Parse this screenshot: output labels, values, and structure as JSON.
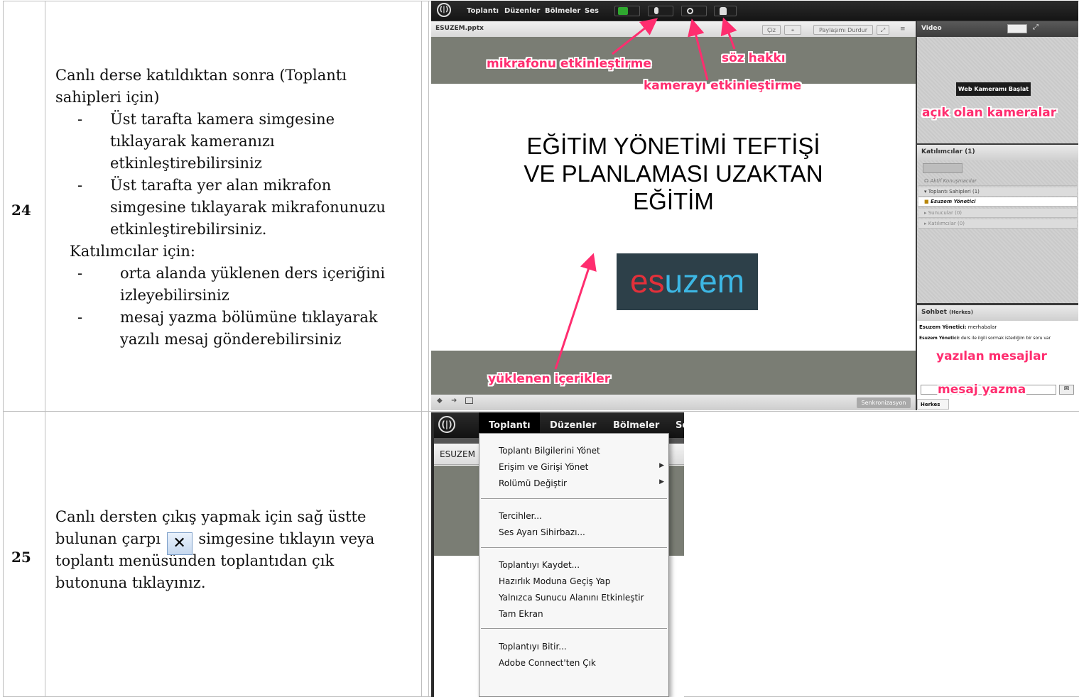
{
  "rows": [
    {
      "number": "24",
      "intro": [
        "Canlı derse katıldıktan sonra (Toplantı",
        "sahipleri için)"
      ],
      "bullets1": [
        [
          "Üst tarafta  kamera simgesine",
          "tıklayarak kameranızı",
          "etkinleştirebilirsiniz"
        ],
        [
          "Üst tarafta yer alan mikrafon",
          "simgesine tıklayarak mikrafonunuzu",
          "etkinleştirebilirsiniz."
        ]
      ],
      "participants_heading": "Katılımcılar için:",
      "bullets2": [
        [
          "orta alanda yüklenen ders içeriğini",
          "izleyebilirsiniz"
        ],
        [
          "mesaj yazma bölümüne tıklayarak",
          "yazılı mesaj gönderebilirsiniz"
        ]
      ],
      "dash": "-"
    },
    {
      "number": "25",
      "line1": "Canlı dersten çıkış yapmak için sağ üstte",
      "line2a": "bulunan çarpı",
      "line2b": "simgesine tıklayın veya",
      "line3": "toplantı menüsünden toplantıdan çık",
      "line4": "butonuna tıklayınız.",
      "close_glyph": "✕"
    }
  ],
  "screenshot1": {
    "menu": [
      "Toplantı",
      "Düzenler",
      "Bölmeler",
      "Ses"
    ],
    "share_pod": {
      "title": "ESUZEM.pptx",
      "draw_btn": "Çiz",
      "stop_btn": "Paylaşımı Durdur",
      "sync_btn": "Senkronizasyon",
      "slide_title": [
        "EĞİTİM YÖNETİMİ TEFTİŞİ",
        "VE PLANLAMASI UZAKTAN",
        "EĞİTİM"
      ],
      "logo_es": "es",
      "logo_uzem": "uzem"
    },
    "video_pod": {
      "title": "Video",
      "start_btn": "Web Kameramı Başlat"
    },
    "attendees_pod": {
      "title": "Katılımcılar",
      "count": "(1)",
      "active": "Aktif Konuşmacılar",
      "hosts": "▾ Toplantı Sahipleri (1)",
      "host_user": "Esuzem Yönetici",
      "presenters": "▸ Sunucular (0)",
      "participants": "▸ Katılımcılar (0)"
    },
    "chat_pod": {
      "title": "Sohbet",
      "scope": "(Herkes)",
      "messages": [
        {
          "user": "Esuzem Yönetici:",
          "text": " merhabalar"
        },
        {
          "user": "Esuzem Yönetici:",
          "text": " ders ile ilgili sormak istediğim bir soru var"
        }
      ],
      "tab": "Herkes"
    },
    "annotations": {
      "mic": "mikrafonu etkinleştirme",
      "cam": "kamerayı etkinleştirme",
      "hand": "söz hakkı",
      "cams": "açık olan kameralar",
      "content": "yüklenen içerikler",
      "msgs": "yazılan mesajlar",
      "write": "mesaj yazma"
    },
    "accent": "#ff2d6f"
  },
  "screenshot2": {
    "menu": [
      "Toplantı",
      "Düzenler",
      "Bölmeler",
      "Se"
    ],
    "pod_title": "ESUZEM",
    "items": [
      "Toplantı Bilgilerini Yönet",
      "Erişim ve Girişi Yönet",
      "Rolümü Değiştir",
      "Tercihler...",
      "Ses Ayarı Sihirbazı...",
      "Toplantıyı Kaydet...",
      "Hazırlık Moduna Geçiş Yap",
      "Yalnızca Sunucu Alanını Etkinleştir",
      "Tam Ekran",
      "Toplantıyı Bitir...",
      "Adobe Connect'ten Çık"
    ]
  }
}
